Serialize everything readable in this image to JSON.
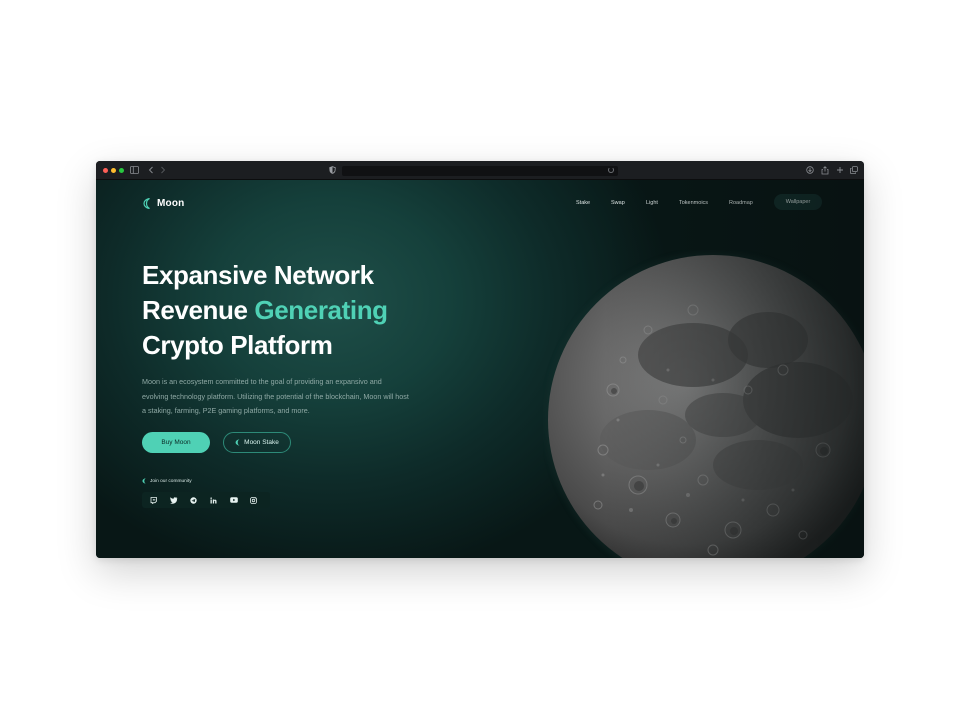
{
  "site": {
    "brand": "Moon",
    "nav": [
      "Stake",
      "Swap",
      "Light",
      "Tokenmoics",
      "Roadmap"
    ],
    "cta_top": "Wallpaper",
    "hero": {
      "line1": "Expansive Network",
      "line2_plain": "Revenue ",
      "line2_accent": "Generating",
      "line3": "Crypto Platform"
    },
    "description": "Moon is an ecosystem committed to the goal of providing an expansivo and evolving technology platform. Utilizing the potential of the blockchain, Moon will host a staking, farming, P2E gaming platforms, and more.",
    "buttons": {
      "buy": "Buy Moon",
      "stake": "Moon Stake"
    },
    "community_label": "Join our community",
    "socials": [
      "twitch-icon",
      "twitter-icon",
      "telegram-icon",
      "linkedin-icon",
      "youtube-icon",
      "instagram-icon"
    ]
  },
  "colors": {
    "accent": "#4fd1b5",
    "background": "#0e2b29",
    "text": "#ffffff"
  }
}
